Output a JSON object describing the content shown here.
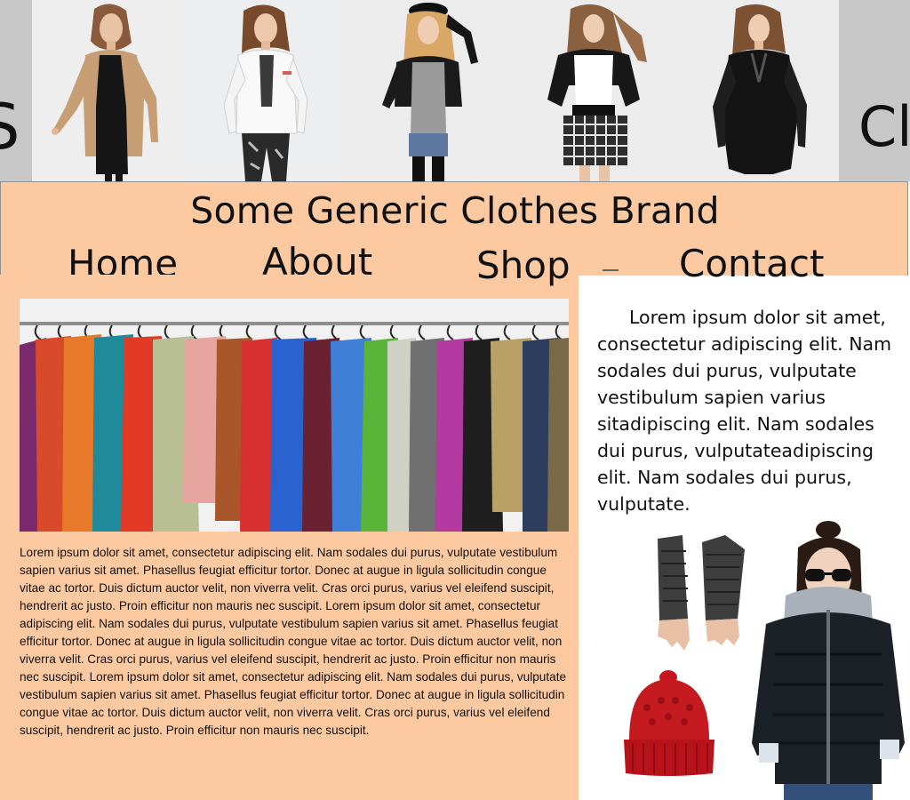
{
  "hero": {
    "left_edge_text": "S",
    "right_edge_text": "Cl"
  },
  "header": {
    "brand": "Some Generic Clothes Brand",
    "nav": [
      {
        "label": "Home"
      },
      {
        "label": "About"
      },
      {
        "label": "Shop"
      },
      {
        "label": "Contact"
      }
    ]
  },
  "main": {
    "body_text": "Lorem ipsum dolor sit amet, consectetur adipiscing elit. Nam sodales dui purus, vulputate vestibulum sapien varius sit amet. Phasellus feugiat efficitur tortor. Donec at augue in ligula sollicitudin congue vitae ac tortor. Duis dictum auctor velit, non viverra velit. Cras orci purus, varius vel eleifend suscipit, hendrerit ac justo. Proin efficitur non mauris nec suscipit. Lorem ipsum dolor sit amet, consectetur adipiscing elit. Nam sodales dui purus, vulputate vestibulum sapien varius sit amet. Phasellus feugiat efficitur tortor. Donec at augue in ligula sollicitudin congue vitae ac tortor. Duis dictum auctor velit, non viverra velit. Cras orci purus, varius vel eleifend suscipit, hendrerit ac justo. Proin efficitur non mauris nec suscipit. Lorem ipsum dolor sit amet, consectetur adipiscing elit. Nam sodales dui purus, vulputate vestibulum sapien varius sit amet. Phasellus feugiat efficitur tortor. Donec at augue in ligula sollicitudin congue vitae ac tortor. Duis dictum auctor velit, non viverra velit. Cras orci purus, varius vel eleifend suscipit, hendrerit ac justo. Proin efficitur non mauris nec suscipit."
  },
  "side": {
    "text": "Lorem ipsum dolor sit amet, consectetur adipiscing elit. Nam sodales dui purus, vulputate vestibulum sapien varius sitadipiscing elit. Nam sodales dui purus, vulputateadipiscing elit. Nam sodales dui purus, vulputate."
  },
  "colors": {
    "panel_peach": "#fcc9a0",
    "hero_grey": "#c7c7c7",
    "text": "#111111"
  },
  "icons": [
    "fashion-model-photo",
    "clothes-rack-photo",
    "fingerless-gloves-photo",
    "knit-beanie-photo",
    "puffer-jacket-photo"
  ]
}
